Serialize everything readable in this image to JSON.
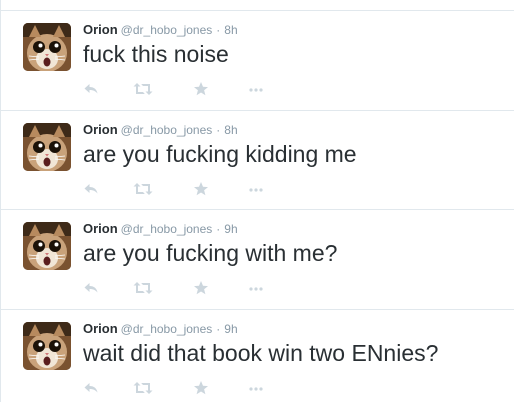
{
  "tweets": [
    {
      "fullname": "Orion",
      "username": "@dr_hobo_jones",
      "separator": "·",
      "time": "8h",
      "text": "fuck this noise"
    },
    {
      "fullname": "Orion",
      "username": "@dr_hobo_jones",
      "separator": "·",
      "time": "8h",
      "text": "are you fucking kidding me"
    },
    {
      "fullname": "Orion",
      "username": "@dr_hobo_jones",
      "separator": "·",
      "time": "9h",
      "text": "are you fucking with me?"
    },
    {
      "fullname": "Orion",
      "username": "@dr_hobo_jones",
      "separator": "·",
      "time": "9h",
      "text": "wait did that book win two ENnies?"
    }
  ],
  "icons": {
    "reply": "reply-icon",
    "retweet": "retweet-icon",
    "favorite": "star-icon",
    "more": "more-dots-icon",
    "avatar": "cat-avatar"
  },
  "colors": {
    "name": "#292f33",
    "meta": "#8899a6",
    "action_icon": "#ccd6dd",
    "divider": "#e1e8ed"
  }
}
